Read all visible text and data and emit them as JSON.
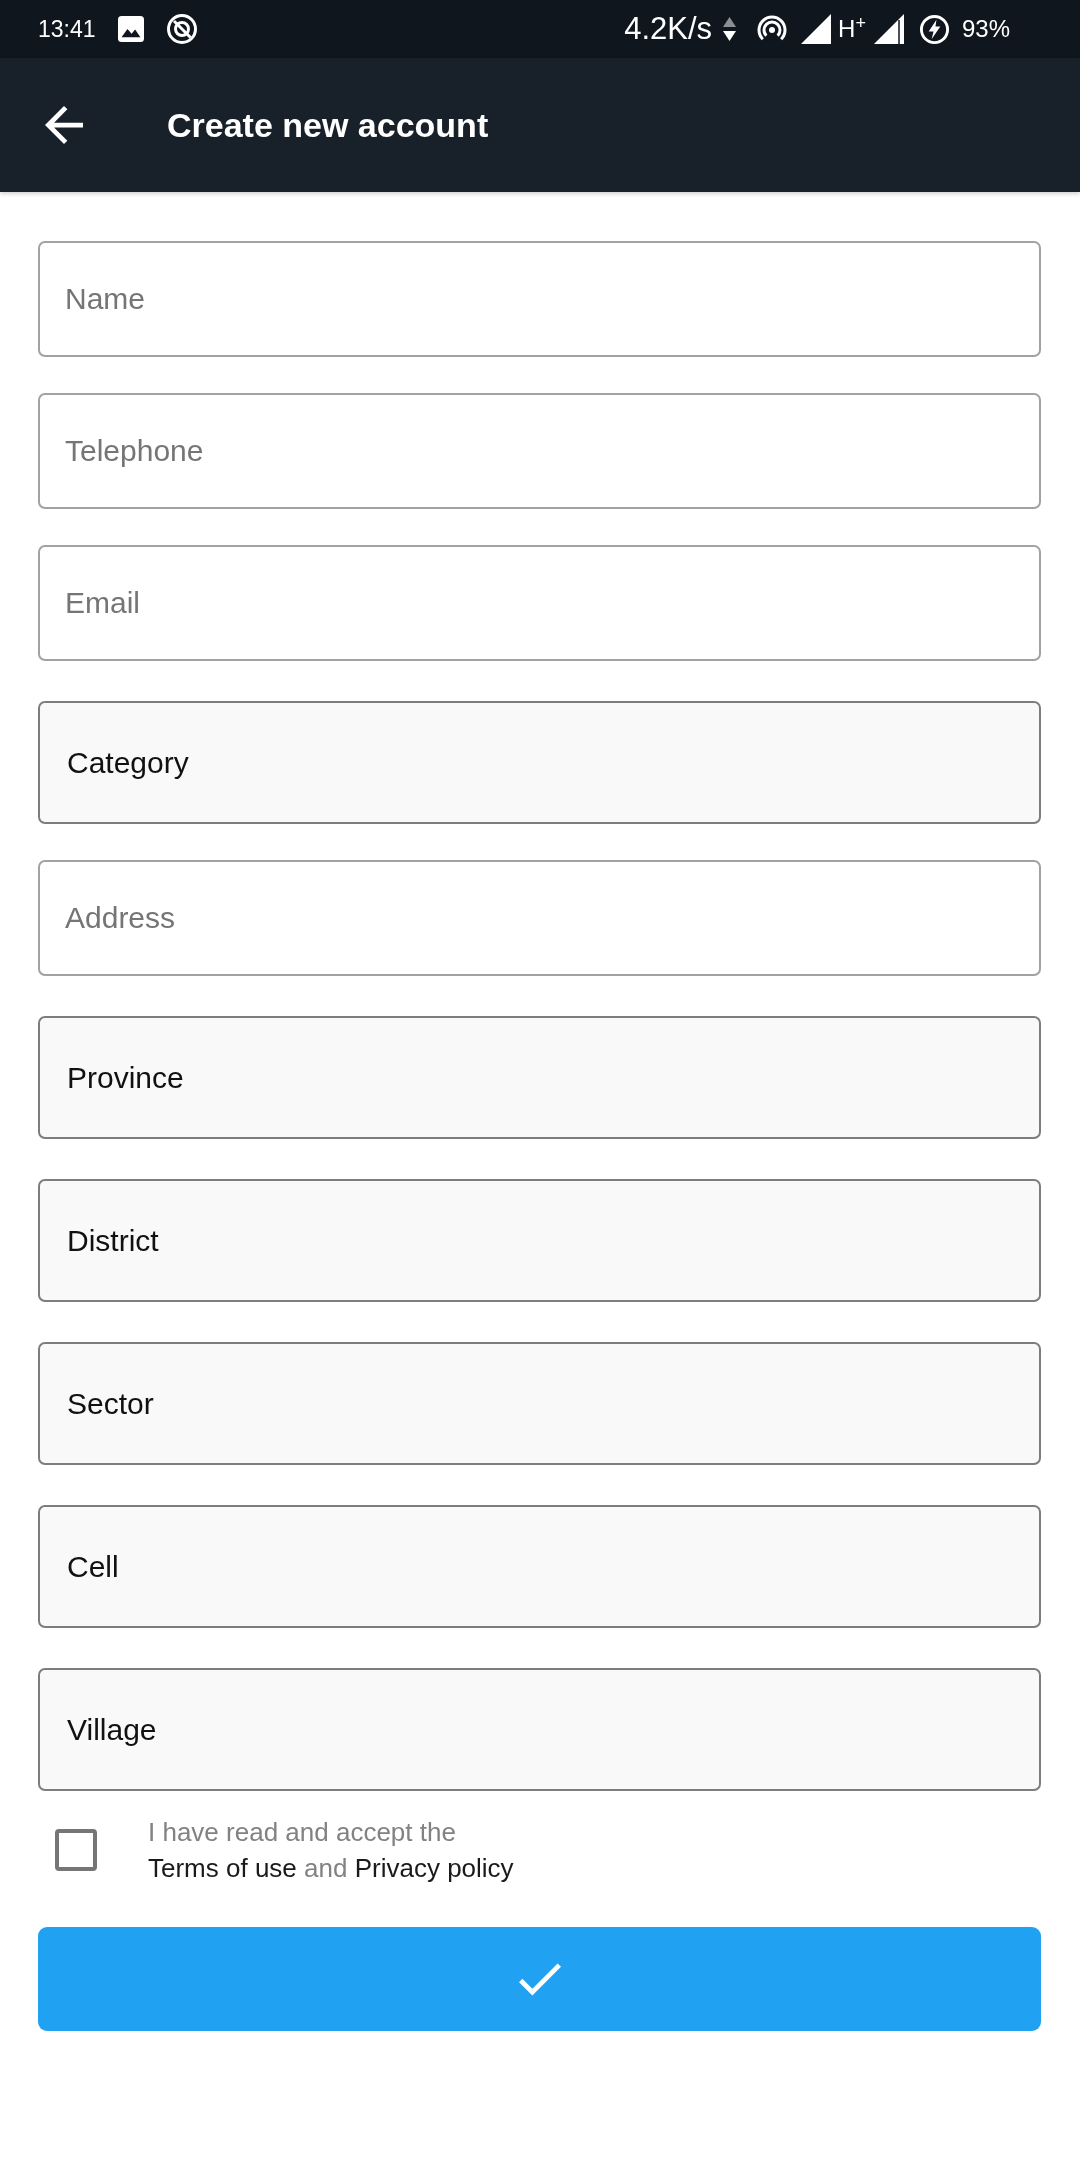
{
  "status_bar": {
    "time": "13:41",
    "net_speed": "4.2K/s",
    "network_type": "H$^{+}$",
    "battery": "93%"
  },
  "app_bar": {
    "title": "Create new account"
  },
  "form": {
    "fields": [
      {
        "kind": "text",
        "placeholder": "Name"
      },
      {
        "kind": "text",
        "placeholder": "Telephone"
      },
      {
        "kind": "text",
        "placeholder": "Email"
      },
      {
        "kind": "select",
        "value": "Category"
      },
      {
        "kind": "text",
        "placeholder": "Address"
      },
      {
        "kind": "select",
        "value": "Province"
      },
      {
        "kind": "select",
        "value": "District"
      },
      {
        "kind": "select",
        "value": "Sector"
      },
      {
        "kind": "select",
        "value": "Cell"
      },
      {
        "kind": "select",
        "value": "Village"
      }
    ]
  },
  "consent": {
    "checked": false,
    "lines": [
      [
        {
          "kind": "plain",
          "text": "I have read and accept the"
        }
      ],
      [
        {
          "kind": "link",
          "text": "Terms of use"
        },
        {
          "kind": "plain",
          "text": "and"
        },
        {
          "kind": "link",
          "text": "Privacy policy"
        }
      ]
    ]
  }
}
